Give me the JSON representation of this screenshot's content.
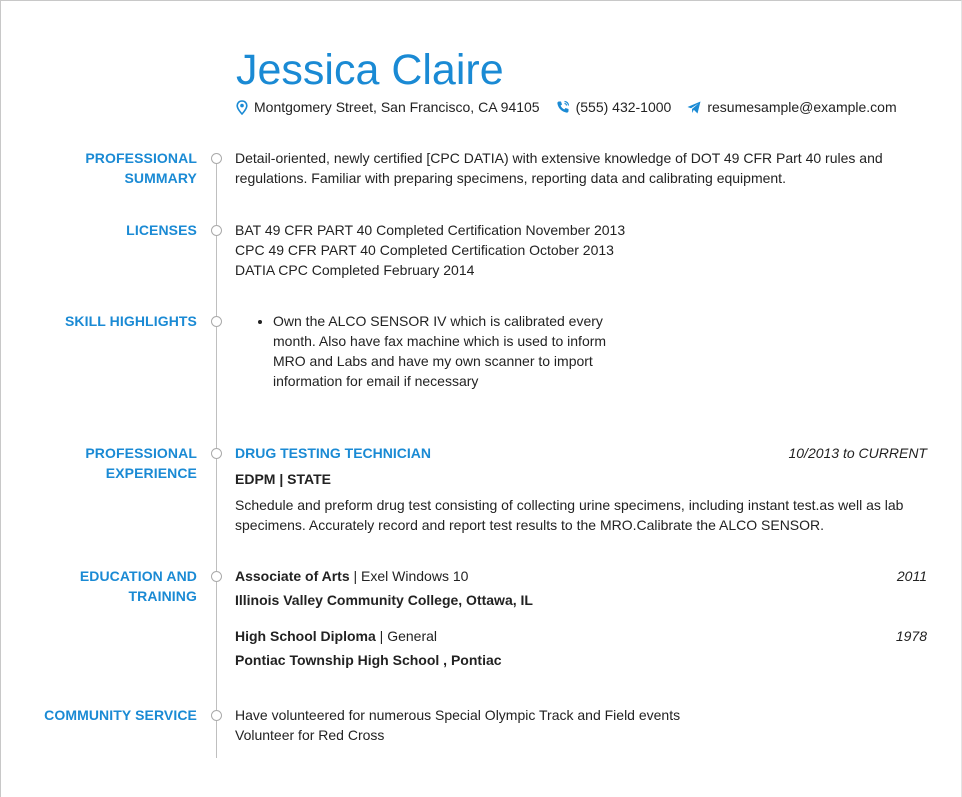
{
  "header": {
    "name": "Jessica Claire",
    "address": "Montgomery Street, San Francisco, CA 94105",
    "phone": "(555) 432-1000",
    "email": "resumesample@example.com"
  },
  "colors": {
    "accent": "#1a8ad4",
    "text": "#222222",
    "timeline": "#bfbfbf"
  },
  "sections": {
    "summary": {
      "title_line1": "PROFESSIONAL",
      "title_line2": "SUMMARY",
      "text": "Detail-oriented, newly certified [CPC DATIA) with extensive knowledge of DOT 49 CFR Part 40 rules and regulations. Familiar with preparing specimens, reporting data and calibrating equipment."
    },
    "licenses": {
      "title": "LICENSES",
      "items": [
        "BAT 49 CFR PART 40 Completed Certification November 2013",
        "CPC 49 CFR PART 40 Completed Certification October 2013",
        "DATIA CPC Completed February 2014"
      ]
    },
    "skills": {
      "title": "SKILL HIGHLIGHTS",
      "items": [
        "Own the ALCO SENSOR IV which is calibrated every month. Also have fax machine which is used to inform MRO and Labs and have my own scanner to import information for email if necessary"
      ]
    },
    "experience": {
      "title_line1": "PROFESSIONAL",
      "title_line2": "EXPERIENCE",
      "job_title": "DRUG TESTING TECHNICIAN",
      "dates": "10/2013 to CURRENT",
      "employer": "EDPM | STATE",
      "description": "Schedule and preform drug test consisting of collecting urine specimens, including instant test.as well as lab specimens. Accurately record and report test results to the MRO.Calibrate the ALCO SENSOR."
    },
    "education": {
      "title_line1": "EDUCATION AND",
      "title_line2": "TRAINING",
      "entries": [
        {
          "degree": "Associate of Arts",
          "field": " | Exel Windows 10",
          "year": "2011",
          "school": "Illinois Valley Community College, Ottawa, IL"
        },
        {
          "degree": "High School Diploma",
          "field": " | General",
          "year": "1978",
          "school": "Pontiac Township High School , Pontiac"
        }
      ]
    },
    "community": {
      "title": "COMMUNITY SERVICE",
      "items": [
        "Have volunteered for numerous Special Olympic Track and Field events",
        "Volunteer for Red Cross"
      ]
    }
  }
}
